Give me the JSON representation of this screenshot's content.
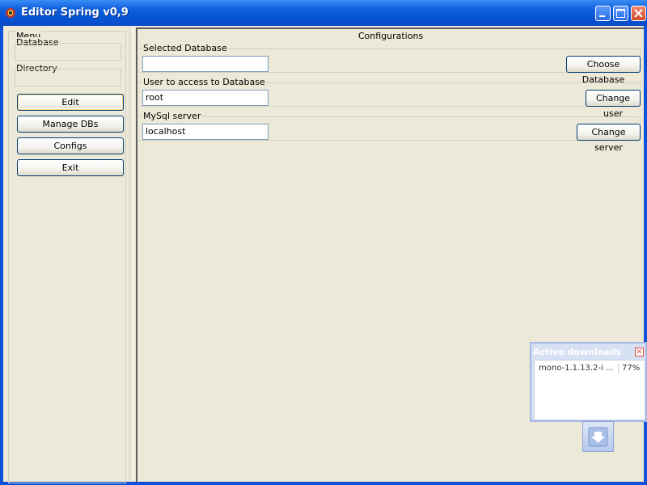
{
  "window": {
    "title": "Editor Spring v0,9"
  },
  "menu": {
    "title": "Menu",
    "database_label": "Database",
    "directory_label": "Directory",
    "buttons": {
      "edit": "Edit",
      "manage": "Manage DBs",
      "configs": "Configs",
      "exit": "Exit"
    }
  },
  "config": {
    "title": "Configurations",
    "selected_db": {
      "label": "Selected Database",
      "value": "",
      "button": "Choose Database"
    },
    "user": {
      "label": "User to access to Database",
      "value": "root",
      "button": "Change user"
    },
    "server": {
      "label": "MySql server",
      "value": "localhost",
      "button": "Change server"
    }
  },
  "downloads": {
    "title": "Active downloads",
    "items": [
      {
        "name": "mono-1.1.13.2-i ...",
        "progress": "77%"
      }
    ]
  },
  "colors": {
    "titlebar": "#0A52D8",
    "panel": "#ECE9D8",
    "downloads_title": "#AFC4EC"
  },
  "icons": {
    "app": "app-icon",
    "minimize": "minimize-icon",
    "maximize": "maximize-icon",
    "close": "close-icon",
    "download": "download-arrow-icon"
  }
}
